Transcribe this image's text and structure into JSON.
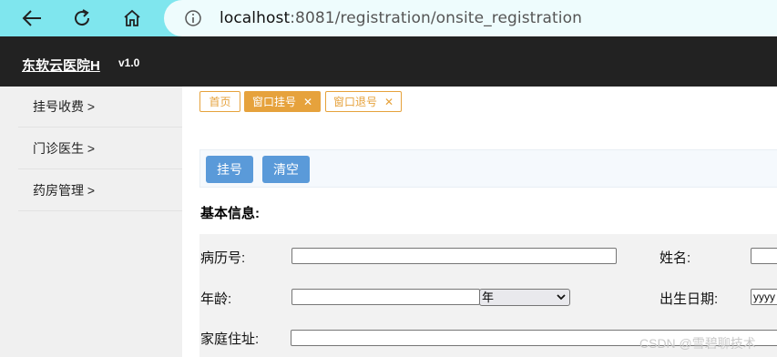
{
  "browser": {
    "url_host": "localhost",
    "url_path": ":8081/registration/onsite_registration"
  },
  "header": {
    "brand": "东软云医院H",
    "version": "v1.0"
  },
  "sidebar": {
    "items": [
      {
        "label": "挂号收费 >"
      },
      {
        "label": "门诊医生 >"
      },
      {
        "label": "药房管理 >"
      }
    ]
  },
  "tabs": [
    {
      "label": "首页"
    },
    {
      "label": "窗口挂号"
    },
    {
      "label": "窗口退号"
    }
  ],
  "tab_close_glyph": "✕",
  "toolbar": {
    "register_label": "挂号",
    "clear_label": "清空"
  },
  "form": {
    "section_title": "基本信息:",
    "record_no_label": "病历号:",
    "name_label": "姓名:",
    "age_label": "年龄:",
    "age_unit_selected": "年",
    "birthdate_label": "出生日期:",
    "birthdate_placeholder": "yyyy",
    "address_label": "家庭住址:"
  },
  "watermark": "CSDN @雪碧聊技术",
  "colors": {
    "browser_bar": "#7fe6ee",
    "header_bg": "#222222",
    "tab_accent": "#e6a23c",
    "button": "#5a9ad9"
  }
}
